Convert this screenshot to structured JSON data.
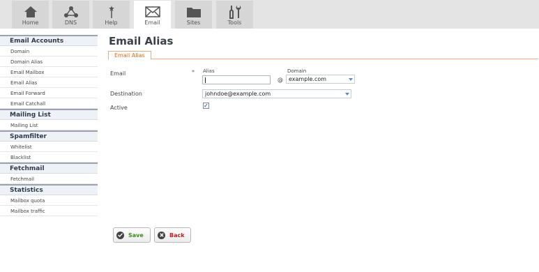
{
  "nav": {
    "tabs": [
      {
        "label": "Home",
        "icon": "home-icon"
      },
      {
        "label": "DNS",
        "icon": "dns-icon"
      },
      {
        "label": "Help",
        "icon": "help-icon"
      },
      {
        "label": "Email",
        "icon": "email-icon",
        "active": true
      },
      {
        "label": "Sites",
        "icon": "sites-icon"
      },
      {
        "label": "Tools",
        "icon": "tools-icon"
      }
    ]
  },
  "sidebar": {
    "sections": [
      {
        "title": "Email Accounts",
        "items": [
          "Domain",
          "Domain Alias",
          "Email Mailbox",
          "Email Alias",
          "Email Forward",
          "Email Catchall"
        ]
      },
      {
        "title": "Mailing List",
        "items": [
          "Mailing List"
        ]
      },
      {
        "title": "Spamfilter",
        "items": [
          "Whitelist",
          "Blacklist"
        ]
      },
      {
        "title": "Fetchmail",
        "items": [
          "Fetchmail"
        ]
      },
      {
        "title": "Statistics",
        "items": [
          "Mailbox quota",
          "Mailbox traffic"
        ]
      }
    ]
  },
  "main": {
    "title": "Email Alias",
    "subtab": "Email Alias",
    "form": {
      "email_label": "Email",
      "required_mark": "*",
      "alias_label": "Alias",
      "alias_value": "",
      "at_sign": "@",
      "domain_label": "Domain",
      "domain_value": "example.com",
      "destination_label": "Destination",
      "destination_value": "johndoe@example.com",
      "active_label": "Active",
      "active_checked": true,
      "checkmark": "✓"
    },
    "buttons": {
      "save_label": "Save",
      "back_label": "Back"
    }
  },
  "colors": {
    "accent_orange": "#e06a10",
    "save_green": "#3a8a1a",
    "back_red": "#c02020"
  }
}
